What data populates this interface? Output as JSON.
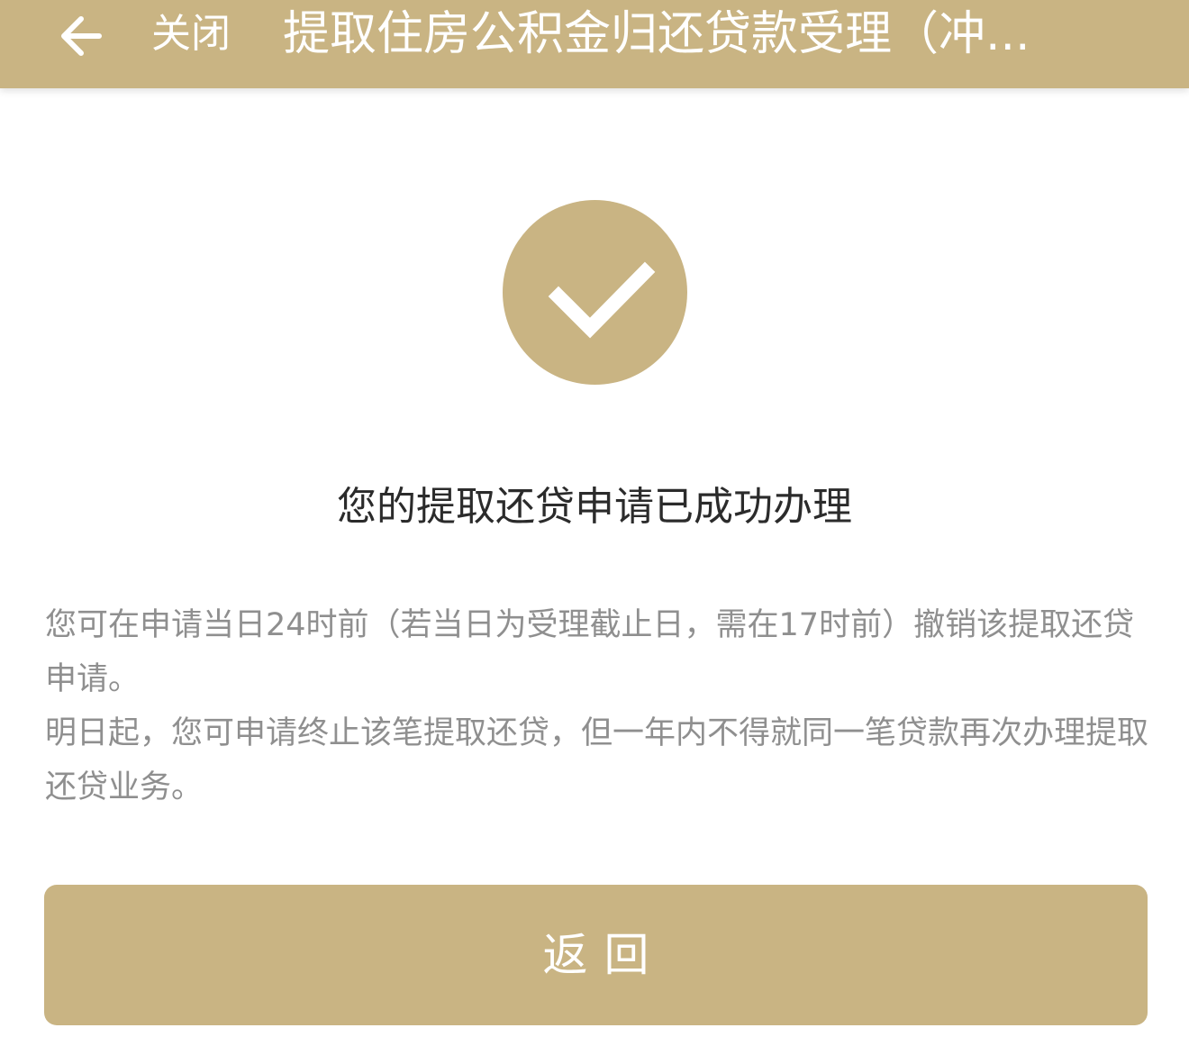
{
  "header": {
    "back_icon": "arrow-left-icon",
    "close_label": "关闭",
    "title": "提取住房公积金归还贷款受理（冲..."
  },
  "result": {
    "icon": "checkmark-icon",
    "title": "您的提取还贷申请已成功办理",
    "paragraphs": [
      "您可在申请当日24时前（若当日为受理截止日，需在17时前）撤销该提取还贷申请。",
      "明日起，您可申请终止该笔提取还贷，但一年内不得就同一笔贷款再次办理提取还贷业务。"
    ]
  },
  "footer": {
    "return_label": "返回"
  },
  "colors": {
    "accent": "#c9b483",
    "title_text": "#2b2b2b",
    "body_text": "#8f8f8f",
    "background": "#ffffff"
  }
}
